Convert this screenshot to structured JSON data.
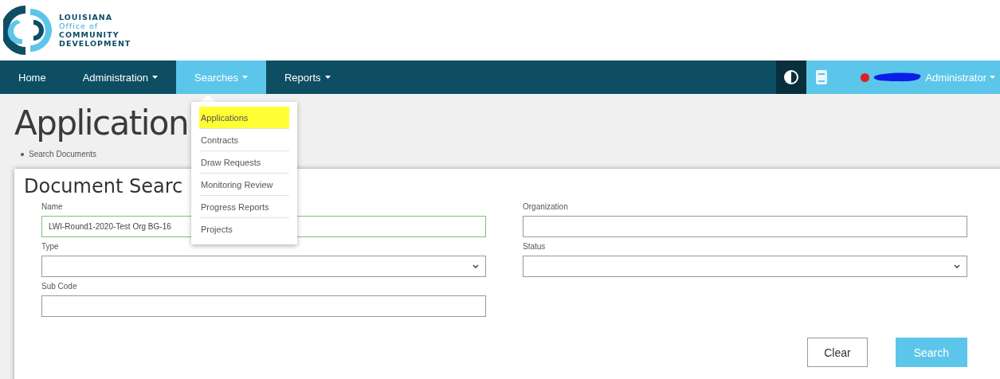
{
  "logo": {
    "lines": [
      "LOUISIANA",
      "Office of",
      "COMMUNITY",
      "DEVELOPMENT"
    ]
  },
  "nav": {
    "items": [
      {
        "label": "Home",
        "has_menu": false,
        "selected": false
      },
      {
        "label": "Administration",
        "has_menu": true,
        "selected": false
      },
      {
        "label": "Searches",
        "has_menu": true,
        "selected": true
      },
      {
        "label": "Reports",
        "has_menu": true,
        "selected": false
      }
    ],
    "user": {
      "label": "Administrator",
      "online": true
    }
  },
  "dropdown": {
    "items": [
      {
        "label": "Applications",
        "highlighted": true
      },
      {
        "label": "Contracts",
        "highlighted": false
      },
      {
        "label": "Draw Requests",
        "highlighted": false
      },
      {
        "label": "Monitoring Review",
        "highlighted": false
      },
      {
        "label": "Progress Reports",
        "highlighted": false
      },
      {
        "label": "Projects",
        "highlighted": false
      }
    ]
  },
  "page_title": "Application",
  "breadcrumbs": [
    "Search Documents"
  ],
  "card": {
    "title": "Document Searc",
    "fields": [
      {
        "label": "Name",
        "kind": "text",
        "value": "LWI-Round1-2020-Test Org BG-16",
        "focused": true
      },
      {
        "label": "Organization",
        "kind": "text",
        "focused": false
      },
      {
        "label": "Type",
        "kind": "select",
        "focused": false
      },
      {
        "label": "Status",
        "kind": "select",
        "focused": false
      },
      {
        "label": "Sub Code",
        "kind": "text",
        "focused": false
      }
    ],
    "buttons": [
      {
        "label": "Clear",
        "kind": "secondary"
      },
      {
        "label": "Search",
        "kind": "primary"
      }
    ]
  }
}
